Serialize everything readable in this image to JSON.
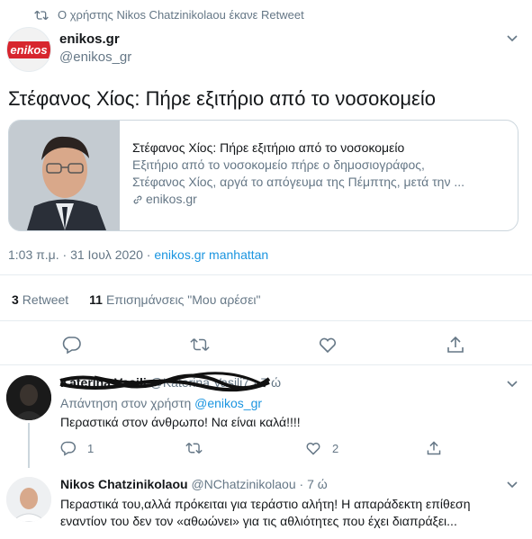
{
  "retweet_header": {
    "text": "Ο χρήστης Nikos Chatzinikolaou έκανε Retweet"
  },
  "tweet": {
    "author_name": "enikos.gr",
    "author_handle": "@enikos_gr",
    "logo_text": "enikos",
    "text": "Στέφανος Χίος: Πήρε εξιτήριο από το νοσοκομείο",
    "card": {
      "title": "Στέφανος Χίος: Πήρε εξιτήριο από το νοσοκομείο",
      "description_line1": "Εξιτήριο από το νοσοκομείο πήρε ο δημοσιογράφος,",
      "description_line2": "Στέφανος Χίος, αργά το απόγευμα της Πέμπτης, μετά την ...",
      "link": "enikos.gr"
    },
    "time": "1:03 π.μ. · 31 Ιουλ 2020 · ",
    "source": "enikos.gr manhattan",
    "stats": {
      "retweets_count": "3",
      "retweets_label": "Retweet",
      "likes_count": "11",
      "likes_label": "Επισημάνσεις \"Μου αρέσει\""
    }
  },
  "replies": [
    {
      "name": "Katerina Vasili",
      "handle": "@Katerina Vasili7",
      "time": "· 7 ώ",
      "reply_to_prefix": "Απάντηση στον χρήστη ",
      "reply_to_mention": "@enikos_gr",
      "text": "Περαστικά στον άνθρωπο! Να είναι καλά!!!!",
      "reply_count": "1",
      "like_count": "2"
    },
    {
      "name": "Nikos Chatzinikolaou",
      "handle": "@NChatzinikolaou",
      "time": "· 7 ώ",
      "text_line1": "Περαστικά του,αλλά πρόκειται για τεράστιο αλήτη! Η απαράδεκτη επίθεση",
      "text_line2": "εναντίον του δεν τον «αθωώνει» για τις αθλιότητες που έχει διαπράξει..."
    }
  ],
  "colors": {
    "accent": "#1b95e0",
    "secondary": "#657786",
    "border": "#e6ecf0",
    "brand_red": "#d7262e"
  }
}
